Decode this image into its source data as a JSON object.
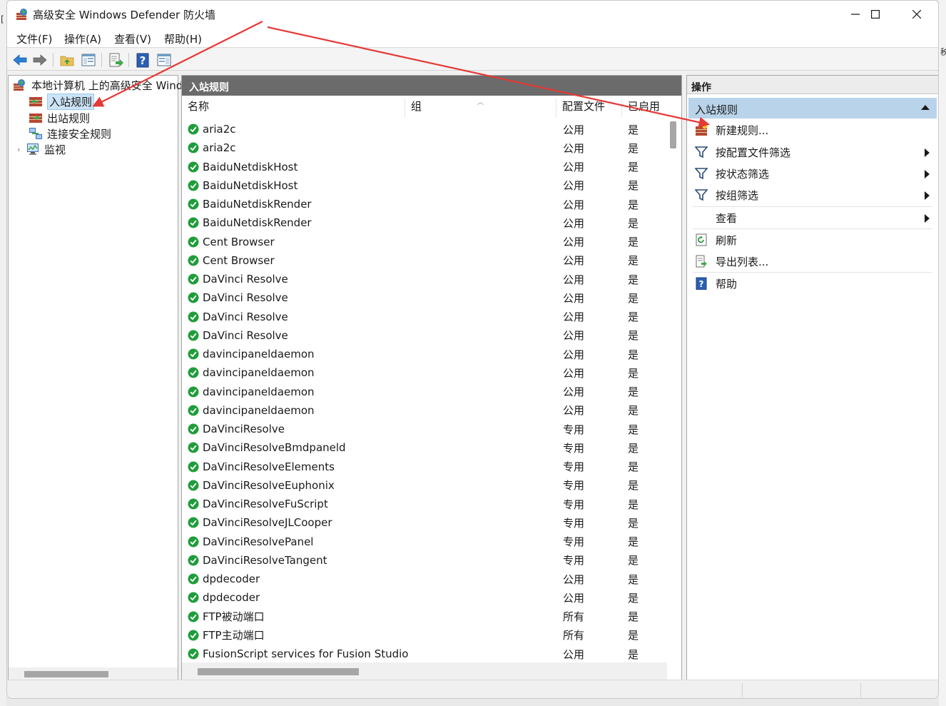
{
  "desktop": {
    "left_glyph": "[",
    "right_glyph": "秭"
  },
  "window": {
    "title": "高级安全 Windows Defender 防火墙",
    "controls": {
      "minimize": "minimize",
      "maximize": "maximize",
      "close": "close"
    }
  },
  "menu": {
    "items": [
      "文件(F)",
      "操作(A)",
      "查看(V)",
      "帮助(H)"
    ]
  },
  "toolbar": {
    "buttons": [
      "back-icon",
      "forward-icon",
      "up-folder-icon",
      "show-hide-console-icon",
      "export-list-icon",
      "help-icon",
      "action-pane-icon"
    ]
  },
  "tree": {
    "root": "本地计算机 上的高级安全 Windows Defender 防火墙",
    "items": [
      {
        "label": "入站规则",
        "selected": true,
        "icon": "inbound-rules-icon"
      },
      {
        "label": "出站规则",
        "selected": false,
        "icon": "outbound-rules-icon"
      },
      {
        "label": "连接安全规则",
        "selected": false,
        "icon": "connection-security-icon"
      },
      {
        "label": "监视",
        "selected": false,
        "icon": "monitor-icon",
        "expandable": true
      }
    ]
  },
  "list": {
    "header": "入站规则",
    "columns": [
      "名称",
      "组",
      "配置文件",
      "已启用"
    ],
    "rows": [
      {
        "name": "aria2c",
        "group": "",
        "profile": "公用",
        "enabled": "是"
      },
      {
        "name": "aria2c",
        "group": "",
        "profile": "公用",
        "enabled": "是"
      },
      {
        "name": "BaiduNetdiskHost",
        "group": "",
        "profile": "公用",
        "enabled": "是"
      },
      {
        "name": "BaiduNetdiskHost",
        "group": "",
        "profile": "公用",
        "enabled": "是"
      },
      {
        "name": "BaiduNetdiskRender",
        "group": "",
        "profile": "公用",
        "enabled": "是"
      },
      {
        "name": "BaiduNetdiskRender",
        "group": "",
        "profile": "公用",
        "enabled": "是"
      },
      {
        "name": "Cent Browser",
        "group": "",
        "profile": "公用",
        "enabled": "是"
      },
      {
        "name": "Cent Browser",
        "group": "",
        "profile": "公用",
        "enabled": "是"
      },
      {
        "name": "DaVinci Resolve",
        "group": "",
        "profile": "公用",
        "enabled": "是"
      },
      {
        "name": "DaVinci Resolve",
        "group": "",
        "profile": "公用",
        "enabled": "是"
      },
      {
        "name": "DaVinci Resolve",
        "group": "",
        "profile": "公用",
        "enabled": "是"
      },
      {
        "name": "DaVinci Resolve",
        "group": "",
        "profile": "公用",
        "enabled": "是"
      },
      {
        "name": "davincipaneldaemon",
        "group": "",
        "profile": "公用",
        "enabled": "是"
      },
      {
        "name": "davincipaneldaemon",
        "group": "",
        "profile": "公用",
        "enabled": "是"
      },
      {
        "name": "davincipaneldaemon",
        "group": "",
        "profile": "公用",
        "enabled": "是"
      },
      {
        "name": "davincipaneldaemon",
        "group": "",
        "profile": "公用",
        "enabled": "是"
      },
      {
        "name": "DaVinciResolve",
        "group": "",
        "profile": "专用",
        "enabled": "是"
      },
      {
        "name": "DaVinciResolveBmdpaneld",
        "group": "",
        "profile": "专用",
        "enabled": "是"
      },
      {
        "name": "DaVinciResolveElements",
        "group": "",
        "profile": "专用",
        "enabled": "是"
      },
      {
        "name": "DaVinciResolveEuphonix",
        "group": "",
        "profile": "专用",
        "enabled": "是"
      },
      {
        "name": "DaVinciResolveFuScript",
        "group": "",
        "profile": "专用",
        "enabled": "是"
      },
      {
        "name": "DaVinciResolveJLCooper",
        "group": "",
        "profile": "专用",
        "enabled": "是"
      },
      {
        "name": "DaVinciResolvePanel",
        "group": "",
        "profile": "专用",
        "enabled": "是"
      },
      {
        "name": "DaVinciResolveTangent",
        "group": "",
        "profile": "专用",
        "enabled": "是"
      },
      {
        "name": "dpdecoder",
        "group": "",
        "profile": "公用",
        "enabled": "是"
      },
      {
        "name": "dpdecoder",
        "group": "",
        "profile": "公用",
        "enabled": "是"
      },
      {
        "name": "FTP被动端口",
        "group": "",
        "profile": "所有",
        "enabled": "是"
      },
      {
        "name": "FTP主动端口",
        "group": "",
        "profile": "所有",
        "enabled": "是"
      },
      {
        "name": "FusionScript services for Fusion Studio",
        "group": "",
        "profile": "公用",
        "enabled": "是"
      }
    ]
  },
  "actions": {
    "header": "操作",
    "group_title": "入站规则",
    "items": [
      {
        "label": "新建规则...",
        "icon": "new-rule-icon",
        "submenu": false
      },
      {
        "label": "按配置文件筛选",
        "icon": "filter-icon",
        "submenu": true
      },
      {
        "label": "按状态筛选",
        "icon": "filter-icon",
        "submenu": true
      },
      {
        "label": "按组筛选",
        "icon": "filter-icon",
        "submenu": true
      },
      {
        "label": "查看",
        "icon": "",
        "submenu": true
      },
      {
        "label": "刷新",
        "icon": "refresh-icon",
        "submenu": false
      },
      {
        "label": "导出列表...",
        "icon": "export-list-icon",
        "submenu": false
      },
      {
        "label": "帮助",
        "icon": "help-icon",
        "submenu": false
      }
    ]
  },
  "colors": {
    "accent_selection": "#cce4f7",
    "actions_group_bg": "#b9d3ea",
    "pane_header_bg": "#6b6b6b",
    "annotation_red": "#e53935",
    "ok_green": "#1f9d3a"
  }
}
